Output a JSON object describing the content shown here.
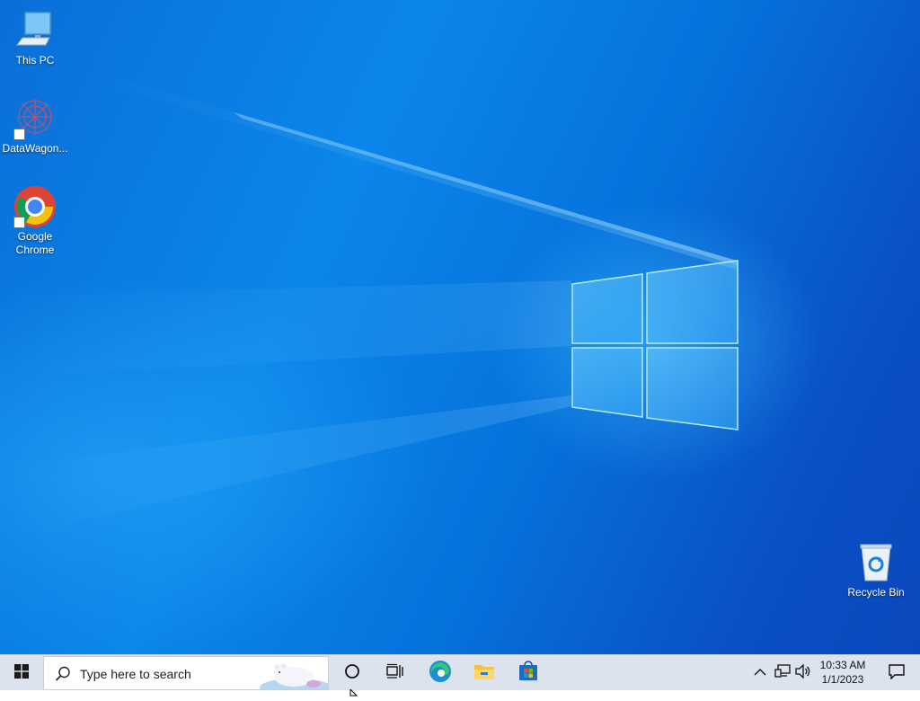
{
  "desktop": {
    "icons": [
      {
        "label": "This PC",
        "icon": "monitor-icon"
      },
      {
        "label": "DataWagon...",
        "icon": "datawagon-icon"
      },
      {
        "label": "Google Chrome",
        "icon": "chrome-icon"
      },
      {
        "label": "Recycle Bin",
        "icon": "recycle-bin-icon"
      }
    ]
  },
  "taskbar": {
    "start_icon": "windows-logo-icon",
    "search": {
      "placeholder": "Type here to search",
      "icon": "search-icon"
    },
    "pinned": [
      "cortana-icon",
      "task-view-icon",
      "edge-icon",
      "file-explorer-icon",
      "store-icon"
    ],
    "tray": {
      "icons": [
        "chevron-up-icon",
        "network-icon",
        "volume-icon"
      ],
      "time": "10:33 AM",
      "date": "1/1/2023",
      "notification_icon": "notification-icon"
    }
  },
  "colors": {
    "wallpaper": "#0b7ee6",
    "taskbar": "#dde3ee",
    "windows_blue": "#0078d4"
  }
}
